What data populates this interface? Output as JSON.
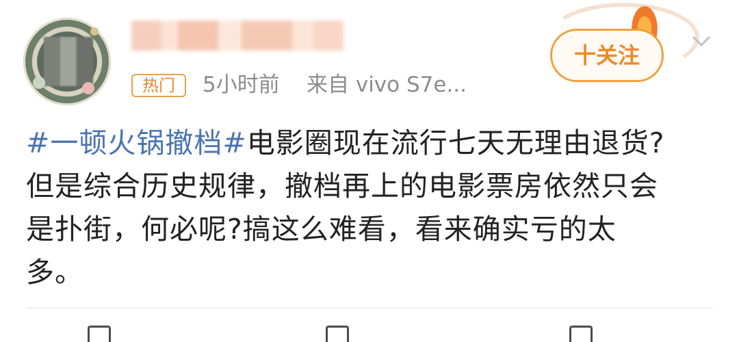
{
  "post": {
    "hot_badge": "热门",
    "time": "5小时前",
    "source": "来自 vivo S7e...",
    "follow_label": "十关注",
    "content": {
      "line1_hashtag": "#一顿火锅撤档#",
      "line1_rest": "电影圈现在流行七天无理由退货?",
      "line2": "但是综合历史规律，撤档再上的电影票房依然只会",
      "line3": "是扑街，何必呢?搞这么难看，看来确实亏的太",
      "line4": "多。"
    },
    "icons": {
      "avatar": "avatar-image",
      "dropdown": "chevron-down-icon"
    },
    "colors": {
      "hashtag": "#4a74b1",
      "accent": "#ee8a22",
      "meta": "#8c8c8c"
    }
  }
}
